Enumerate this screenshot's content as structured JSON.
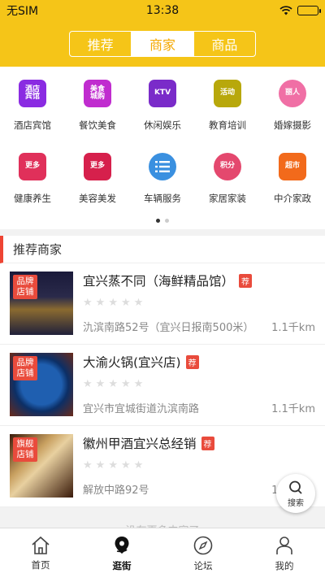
{
  "status": {
    "carrier": "无SIM",
    "time": "13:38"
  },
  "tabs": [
    {
      "label": "推荐",
      "active": false
    },
    {
      "label": "商家",
      "active": true
    },
    {
      "label": "商品",
      "active": false
    }
  ],
  "categories": [
    {
      "label": "酒店宾馆",
      "icon_text": "酒店\n宾馆",
      "color": "#8a2be2"
    },
    {
      "label": "餐饮美食",
      "icon_text": "美食\n城购",
      "color": "#c02ccf"
    },
    {
      "label": "休闲娱乐",
      "icon_text": "KTV",
      "color": "#7a2bc9"
    },
    {
      "label": "教育培训",
      "icon_text": "活动",
      "color": "#b8a80b"
    },
    {
      "label": "婚嫁摄影",
      "icon_text": "丽人",
      "color": "#f06fa5"
    },
    {
      "label": "健康养生",
      "icon_text": "更多",
      "color": "#e0305a"
    },
    {
      "label": "美容美发",
      "icon_text": "更多",
      "color": "#d6204c"
    },
    {
      "label": "车辆服务",
      "icon_text": "list",
      "color": "#3a90e0"
    },
    {
      "label": "家居家装",
      "icon_text": "积分",
      "color": "#e4486e"
    },
    {
      "label": "中介家政",
      "icon_text": "超市",
      "color": "#f26a1b"
    }
  ],
  "section_title": "推荐商家",
  "shops": [
    {
      "badge": "品牌\n店铺",
      "name": "宜兴蒸不同（海鲜精品馆）",
      "rec": "荐",
      "address": "氿滨南路52号（宜兴日报南500米）",
      "distance": "1.1千km",
      "rating": 0
    },
    {
      "badge": "品牌\n店铺",
      "name": "大渝火锅(宜兴店)",
      "rec": "荐",
      "address": "宜兴市宜城街道氿滨南路",
      "distance": "1.1千km",
      "rating": 0
    },
    {
      "badge": "旗舰\n店铺",
      "name": "徽州甲酒宜兴总经销",
      "rec": "荐",
      "address": "解放中路92号",
      "distance": "1.1千km",
      "rating": 0
    }
  ],
  "no_more": "没有更多内容了",
  "search_fab": "搜索",
  "bottom_nav": [
    {
      "label": "首页",
      "active": false
    },
    {
      "label": "逛街",
      "active": true
    },
    {
      "label": "论坛",
      "active": false
    },
    {
      "label": "我的",
      "active": false
    }
  ]
}
